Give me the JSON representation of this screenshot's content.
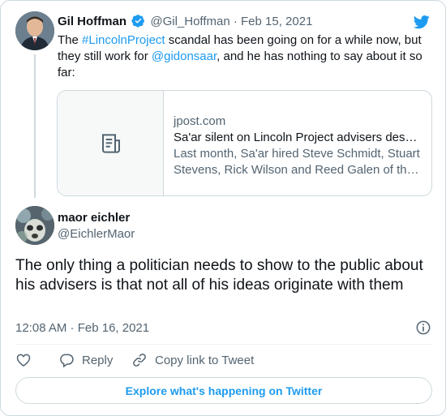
{
  "quoted": {
    "name": "Gil Hoffman",
    "handle": "@Gil_Hoffman",
    "separator": "·",
    "date": "Feb 15, 2021",
    "text_1": "The ",
    "hashtag": "#LincolnProject",
    "text_2": " scandal has been going on for a while now, but they still work for ",
    "mention": "@gidonsaar",
    "text_3": ", and he has nothing to say about it so far:"
  },
  "link_card": {
    "domain": "jpost.com",
    "title": "Sa'ar silent on Lincoln Project advisers des…",
    "description": "Last month, Sa'ar hired Steve Schmidt, Stuart Stevens, Rick Wilson and Reed Galen of th…",
    "thumb_icon": "article-icon"
  },
  "tweet": {
    "name": "maor eichler",
    "handle": "@EichlerMaor",
    "text": "The only thing a politician needs to show to the public about his advisers is that not all of his ideas originate with them",
    "timestamp": "12:08 AM · Feb 16, 2021"
  },
  "actions": {
    "like_icon": "heart-icon",
    "reply_label": "Reply",
    "copy_link_label": "Copy link to Tweet"
  },
  "explore_label": "Explore what's happening on Twitter",
  "colors": {
    "accent": "#1d9bf0",
    "text": "#0f1419",
    "muted": "#536471",
    "border": "#cfd9de"
  }
}
